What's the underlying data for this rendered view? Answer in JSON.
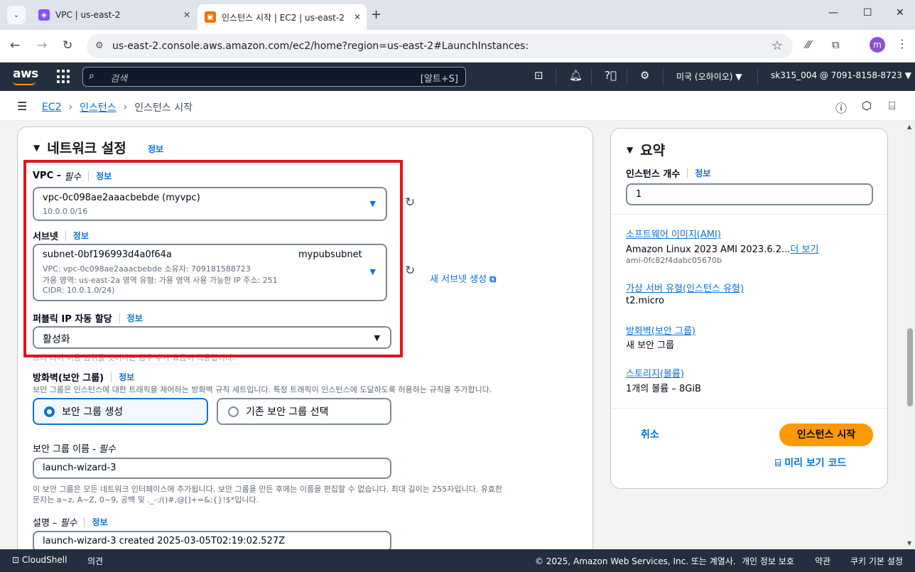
{
  "browser": {
    "tabs": [
      {
        "title": "VPC | us-east-2",
        "favicon_color": "#8c4fff"
      },
      {
        "title": "인스턴스 시작 | EC2 | us-east-2",
        "favicon_color": "#ed7100"
      }
    ],
    "url": "us-east-2.console.aws.amazon.com/ec2/home?region=us-east-2#LaunchInstances:",
    "profile_initial": "m"
  },
  "aws_nav": {
    "logo": "aws",
    "search_placeholder": "검색",
    "search_shortcut": "[알트+S]",
    "region": "미국 (오하이오) ▼",
    "account": "sk315_004 @ 7091-8158-8723 ▼"
  },
  "breadcrumb": {
    "items": [
      "EC2",
      "인스턴스"
    ],
    "current": "인스턴스 시작"
  },
  "network": {
    "title": "네트워크 설정",
    "info": "정보",
    "vpc_label": "VPC –",
    "vpc_required": "필수",
    "vpc_info": "정보",
    "vpc_value": "vpc-0c098ae2aaacbebde (myvpc)",
    "vpc_cidr": "10.0.0.0/16",
    "subnet_label": "서브넷",
    "subnet_info": "정보",
    "subnet_id": "subnet-0bf196993d4a0f64a",
    "subnet_name": "mypubsubnet",
    "subnet_line1": "VPC: vpc-0c098ae2aaacbebde     소유자: 709181588723",
    "subnet_line2": "가용 영역: us-east-2a     영역 유형: 가용 영역     사용 가능한 IP 주소: 251",
    "subnet_line3": "CIDR: 10.0.1.0/24)",
    "new_subnet": "새 서브넷 생성",
    "public_ip_label": "퍼블릭 IP 자동 할당",
    "public_ip_info": "정보",
    "public_ip_value": "활성화",
    "public_ip_help": "프리 티어 이용 범위를 벗어나는 경우 추가 요금이 적용됩니다.",
    "firewall_label": "방화벽(보안 그룹)",
    "firewall_info": "정보",
    "firewall_help": "보안 그룹은 인스턴스에 대한 트래픽을 제어하는 방화벽 규칙 세트입니다. 특정 트래픽이 인스턴스에 도달하도록 허용하는 규칙을 추가합니다.",
    "sg_create": "보안 그룹 생성",
    "sg_existing": "기존 보안 그룹 선택",
    "sg_name_label": "보안 그룹 이름 -",
    "sg_name_required": "필수",
    "sg_name_value": "launch-wizard-3",
    "sg_name_help1": "이 보안 그룹은 모든 네트워크 인터페이스에 추가됩니다. 보안 그룹을 만든 후에는 이름을 편집할 수 없습니다. 최대 길이는 255자입니다. 유효한",
    "sg_name_help2": "문자는 a~z, A~Z, 0~9, 공백 및 ._-:/()#,@[]+=&;{}!$*입니다.",
    "desc_label": "설명 –",
    "desc_required": "필수",
    "desc_info": "정보",
    "desc_value": "launch-wizard-3 created 2025-03-05T02:19:02.527Z"
  },
  "summary": {
    "title": "요약",
    "count_label": "인스턴스 개수",
    "count_info": "정보",
    "count_value": "1",
    "ami_label": "소프트웨어 이미지(AMI)",
    "ami_value": "Amazon Linux 2023 AMI 2023.6.2...",
    "ami_more": "더 보기",
    "ami_id": "ami-0fc82f4dabc05670b",
    "type_label": "가상 서버 유형(인스턴스 유형)",
    "type_value": "t2.micro",
    "fw_label": "방화벽(보안 그룹)",
    "fw_value": "새 보안 그룹",
    "storage_label": "스토리지(볼륨)",
    "storage_value": "1개의 볼륨 – 8GiB",
    "cancel": "취소",
    "launch": "인스턴스 시작",
    "preview": "미리 보기 코드"
  },
  "footer": {
    "cloudshell": "CloudShell",
    "feedback": "의견",
    "copyright": "© 2025, Amazon Web Services, Inc. 또는 계열사.",
    "privacy": "개인 정보 보호",
    "terms": "약관",
    "cookies": "쿠키 기본 설정"
  }
}
